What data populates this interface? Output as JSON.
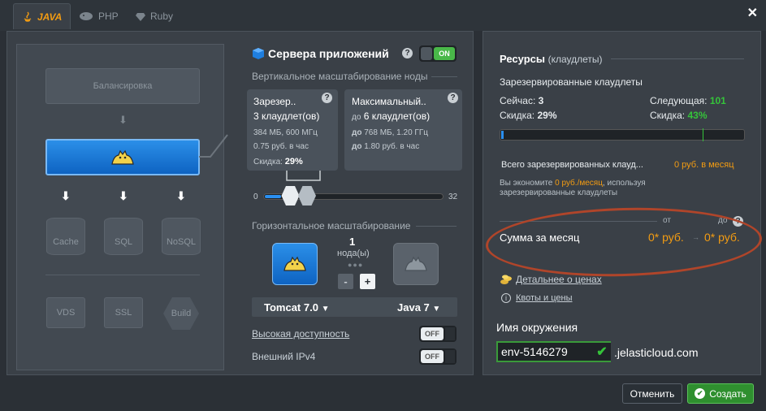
{
  "tabs": [
    {
      "label": "JAVA",
      "icon": "java-icon"
    },
    {
      "label": "PHP",
      "icon": "php-icon"
    },
    {
      "label": "Ruby",
      "icon": "ruby-icon"
    }
  ],
  "topology": {
    "balancer": "Балансировка",
    "db": [
      "Cache",
      "SQL",
      "NoSQL"
    ],
    "extras": [
      "VDS",
      "SSL",
      "Build"
    ]
  },
  "servers": {
    "title": "Сервера приложений",
    "toggle": "ON",
    "vertical_title": "Вертикальное масштабирование ноды",
    "reserved": {
      "title": "Зарезер..",
      "cloudlets": "3 клаудлет(ов)",
      "spec": "384 МБ, 600 МГц",
      "price": "0.75 руб. в час",
      "discount_label": "Скидка:",
      "discount": "29%"
    },
    "maximum": {
      "title": "Максимальный..",
      "prefix": "до",
      "cloudlets": "6 клаудлет(ов)",
      "spec": "768 МБ, 1.20 ГГц",
      "price": "1.80 руб. в час"
    },
    "slider_min": "0",
    "slider_max": "32",
    "slider_reserved_fraction": 0.094,
    "slider_max_fraction": 0.188,
    "horizontal_title": "Горизонтальное масштабирование",
    "nodes_count": "1",
    "nodes_label": "нода(ы)",
    "minus": "-",
    "plus": "+",
    "server_select": "Tomcat 7.0",
    "java_select": "Java 7",
    "ha_label": "Высокая доступность",
    "ha_toggle": "OFF",
    "ipv4_label": "Внешний IPv4",
    "ipv4_toggle": "OFF"
  },
  "resources": {
    "title": "Ресурсы",
    "title_unit": "(клаудлеты)",
    "reserved_title": "Зарезервированные клаудлеты",
    "now_label": "Сейчас:",
    "now_value": "3",
    "next_label": "Следующая:",
    "next_value": "101",
    "discount_label": "Скидка:",
    "discount_now": "29%",
    "discount_next": "43%",
    "total_label": "Всего зарезервированных клауд...",
    "total_value": "0 руб. в месяц",
    "save_prefix": "Вы экономите",
    "save_value": "0 руб./месяц",
    "save_suffix": ", используя",
    "save_line2": "зарезервированные клаудлеты",
    "from_label": "от",
    "to_label": "до",
    "sum_label": "Сумма за месяц",
    "sum_from": "0* руб.",
    "sum_to": "0* руб.",
    "details_link": "Детальнее о ценах",
    "quotas_link": "Квоты и цены",
    "env_label": "Имя окружения",
    "env_value": "env-5146279",
    "env_domain": ".jelasticloud.com"
  },
  "footer": {
    "cancel": "Отменить",
    "create": "Создать"
  },
  "colors": {
    "accent_orange": "#f39c12",
    "accent_blue": "#1877db",
    "accent_green": "#35c33a",
    "highlight_ellipse": "#b0452a"
  }
}
